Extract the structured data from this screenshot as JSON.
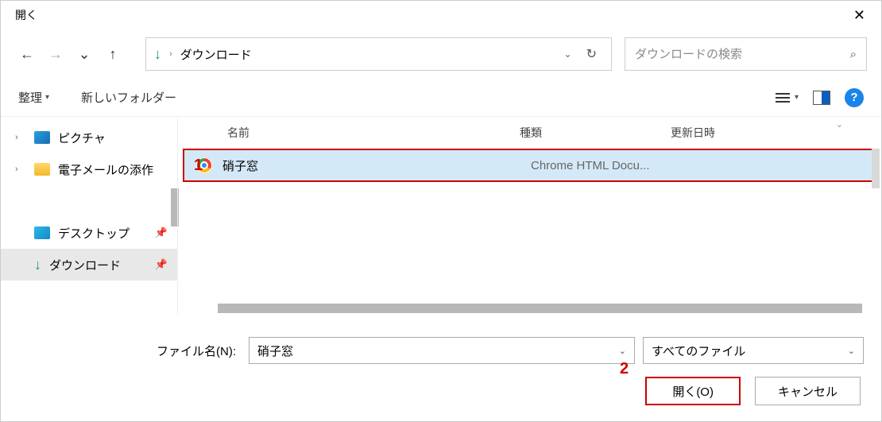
{
  "title": "開く",
  "address": {
    "location": "ダウンロード"
  },
  "search": {
    "placeholder": "ダウンロードの検索"
  },
  "toolbar": {
    "organize": "整理",
    "new_folder": "新しいフォルダー"
  },
  "sidebar": {
    "items": [
      {
        "label": "ピクチャ",
        "expandable": true
      },
      {
        "label": "電子メールの添作",
        "expandable": true
      },
      {
        "label": "デスクトップ",
        "pinned": true
      },
      {
        "label": "ダウンロード",
        "pinned": true,
        "selected": true
      }
    ]
  },
  "columns": {
    "name": "名前",
    "type": "種類",
    "date": "更新日時"
  },
  "files": [
    {
      "name": "硝子窓",
      "type": "Chrome HTML Docu..."
    }
  ],
  "filename": {
    "label": "ファイル名(N):",
    "value": "硝子窓"
  },
  "filetype": {
    "value": "すべてのファイル"
  },
  "buttons": {
    "open": "開く(O)",
    "cancel": "キャンセル"
  },
  "annotations": {
    "a1": "1",
    "a2": "2"
  }
}
